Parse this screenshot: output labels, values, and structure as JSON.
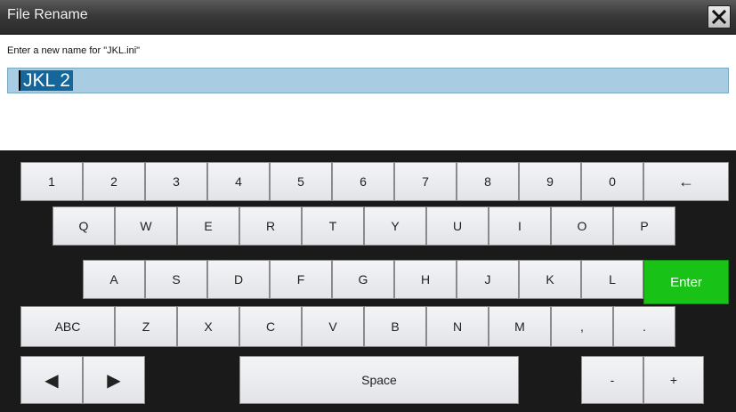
{
  "window": {
    "title": "File Rename"
  },
  "dialog": {
    "prompt": "Enter a new name for \"JKL.ini\"",
    "input_value": "JKL 2"
  },
  "colors": {
    "enter_key": "#19c216",
    "selection": "#15669b",
    "field_bg": "#a8cde2"
  },
  "keyboard": {
    "rows": [
      [
        "1",
        "2",
        "3",
        "4",
        "5",
        "6",
        "7",
        "8",
        "9",
        "0",
        "←"
      ],
      [
        "Q",
        "W",
        "E",
        "R",
        "T",
        "Y",
        "U",
        "I",
        "O",
        "P"
      ],
      [
        "A",
        "S",
        "D",
        "F",
        "G",
        "H",
        "J",
        "K",
        "L",
        "Enter"
      ],
      [
        "ABC",
        "Z",
        "X",
        "C",
        "V",
        "B",
        "N",
        "M",
        ",",
        "."
      ],
      [
        "◀",
        "▶",
        "Space",
        "-",
        "+"
      ]
    ]
  }
}
